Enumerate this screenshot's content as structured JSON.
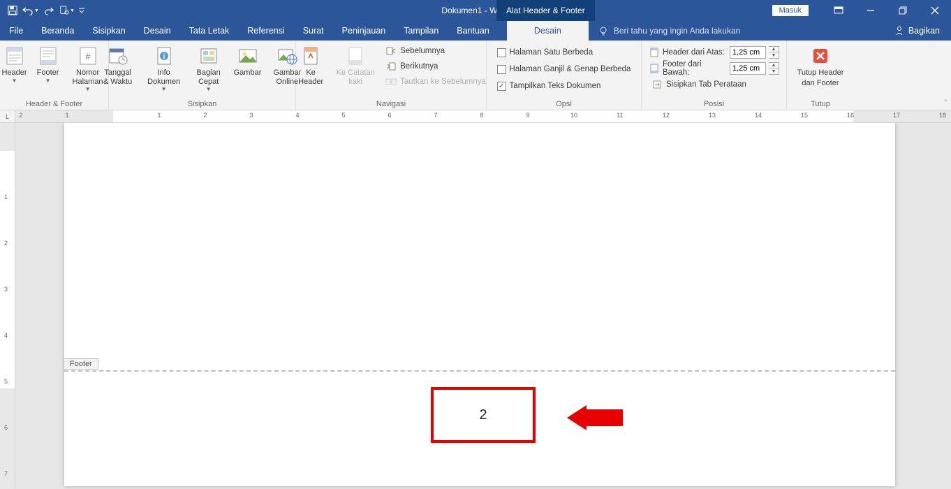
{
  "titlebar": {
    "doc_title": "Dokumen1  -  Word",
    "tool_tab": "Alat Header & Footer",
    "signin": "Masuk"
  },
  "tabs": {
    "file": "File",
    "beranda": "Beranda",
    "sisipkan": "Sisipkan",
    "desain": "Desain",
    "tataletak": "Tata Letak",
    "referensi": "Referensi",
    "surat": "Surat",
    "peninjauan": "Peninjauan",
    "tampilan": "Tampilan",
    "bantuan": "Bantuan",
    "hf_desain": "Desain",
    "tellme": "Beri tahu yang ingin Anda lakukan",
    "share": "Bagikan"
  },
  "ribbon": {
    "groups": {
      "hf": "Header & Footer",
      "sisipkan": "Sisipkan",
      "nav": "Navigasi",
      "opsi": "Opsi",
      "posisi": "Posisi",
      "tutup": "Tutup"
    },
    "hf": {
      "header": "Header",
      "footer": "Footer",
      "nomor": "Nomor Halaman"
    },
    "ins": {
      "tanggal": "Tanggal & Waktu",
      "info": "Info Dokumen",
      "bagian": "Bagian Cepat",
      "gambar": "Gambar",
      "gambaronline": "Gambar Online"
    },
    "nav": {
      "keheader": "Ke Header",
      "kecatatan": "Ke Catatan kaki",
      "sebelumnya": "Sebelumnya",
      "berikutnya": "Berikutnya",
      "tautkan": "Tautkan ke Sebelumnya"
    },
    "opsi": {
      "halsatu": "Halaman Satu Berbeda",
      "ganjil": "Halaman Ganjil & Genap Berbeda",
      "teks": "Tampilkan Teks Dokumen"
    },
    "pos": {
      "headerdari": "Header dari Atas:",
      "footerdari": "Footer dari Bawah:",
      "sisiptab": "Sisipkan Tab Perataan",
      "val1": "1,25 cm",
      "val2": "1,25 cm"
    },
    "close": {
      "line1": "Tutup Header",
      "line2": "dan Footer"
    }
  },
  "doc": {
    "footer_tag": "Footer",
    "page_number": "2"
  }
}
